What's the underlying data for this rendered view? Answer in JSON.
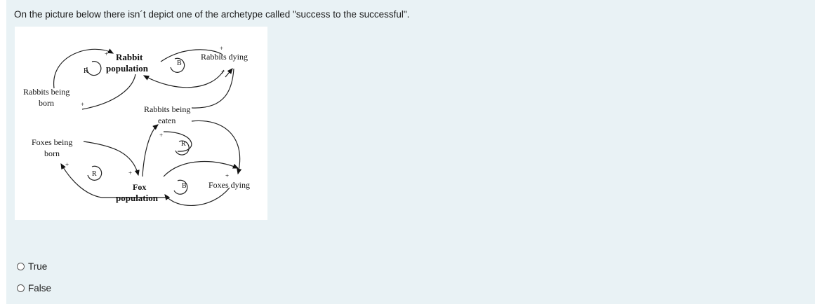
{
  "question": {
    "text": "On the picture below there isn´t depict one of the archetype called \"success to the successful\"."
  },
  "diagram": {
    "labels": {
      "rabbit_population_line1": "Rabbit",
      "rabbit_population_line2": "population",
      "rabbits_dying": "Rabbits dying",
      "rabbits_being_born_line1": "Rabbits being",
      "rabbits_being_born_line2": "born",
      "rabbits_being_eaten_line1": "Rabbits being",
      "rabbits_being_eaten_line2": "eaten",
      "foxes_being_born_line1": "Foxes being",
      "foxes_being_born_line2": "born",
      "fox_population_line1": "Fox",
      "fox_population_line2": "population",
      "foxes_dying": "Foxes dying"
    },
    "loop_markers": {
      "rabbit_birth_loop": "R",
      "rabbit_death_loop": "B",
      "predation_loop": "R",
      "fox_birth_loop": "R",
      "fox_death_loop": "B"
    },
    "polarity": {
      "plus": "+",
      "minus": "-"
    }
  },
  "options": [
    {
      "label": "True"
    },
    {
      "label": "False"
    }
  ]
}
